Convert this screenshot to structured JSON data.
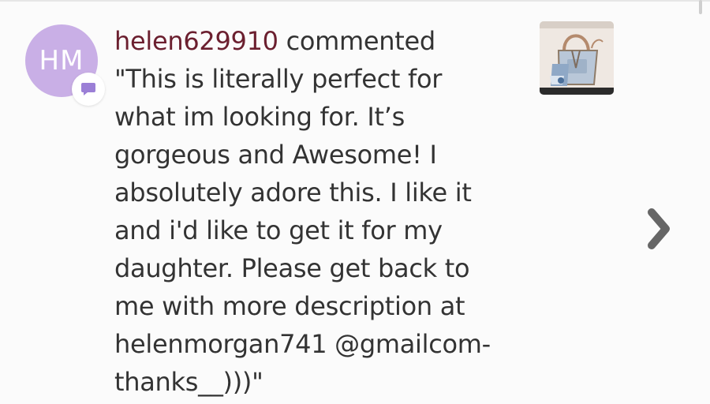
{
  "notification": {
    "avatar_initials": "HM",
    "username": "helen629910",
    "action": "commented",
    "comment_lines": [
      "\"This is literally perfect for",
      "what im looking for. It’s",
      "gorgeous and Awesome! I",
      "absolutely adore this. I like it",
      "and i'd like to get it for my",
      "daughter. Please get back to",
      "me with more description at",
      "helenmorgan741 @gmailcom-",
      "thanks__)))\""
    ],
    "badge_icon": "comment-icon",
    "thumbnail_icon": "product-thumbnail",
    "next_icon": "chevron-right-icon"
  },
  "colors": {
    "avatar_bg": "#c9afe6",
    "badge_icon": "#9b7fd6",
    "username": "#6b1f2f",
    "text": "#333333",
    "chevron": "#666666",
    "background": "#fbfbfb"
  }
}
